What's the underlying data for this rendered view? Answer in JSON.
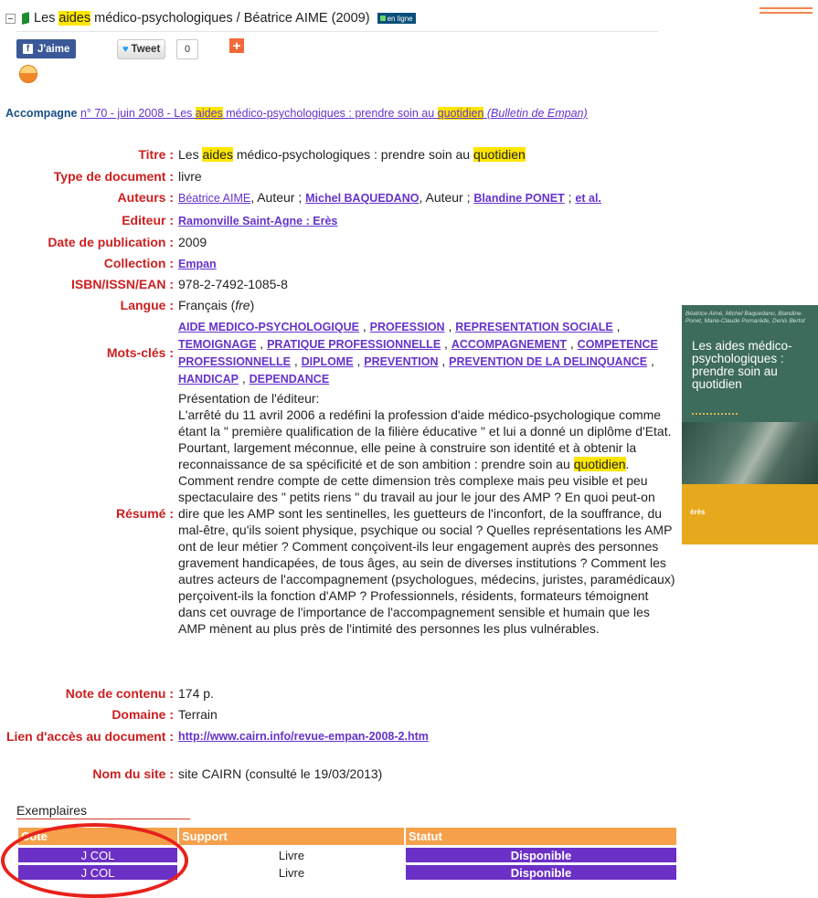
{
  "header": {
    "title_pre": "Les ",
    "title_highlight": "aides",
    "title_post": " médico-psychologiques / Béatrice AIME (2009)",
    "online_badge": "en ligne"
  },
  "share": {
    "facebook_label": "J'aime",
    "tweet_label": "Tweet",
    "tweet_count": "0",
    "plus_label": "+"
  },
  "accompagne": {
    "label": "Accompagne",
    "link_pre": "n° 70 - juin 2008 - Les ",
    "link_hl1": "aides",
    "link_mid": " médico-psychologiques : prendre soin au ",
    "link_hl2": "quotidien",
    "link_post": " (Bulletin de Empan)"
  },
  "fields": {
    "titre": {
      "label": "Titre :",
      "pre": "Les ",
      "hl1": "aides",
      "mid": " médico-psychologiques : prendre soin au ",
      "hl2": "quotidien"
    },
    "type": {
      "label": "Type de document :",
      "value": "livre"
    },
    "auteurs": {
      "label": "Auteurs :",
      "a1": "Béatrice AIME",
      "role": ", Auteur ; ",
      "a2": "Michel BAQUEDANO",
      "role2": ", Auteur ; ",
      "a3": "Blandine PONET",
      "sep": " ; ",
      "a4": "et al."
    },
    "editeur": {
      "label": "Editeur :",
      "value": "Ramonville Saint-Agne : Erès"
    },
    "date": {
      "label": "Date de publication :",
      "value": "2009"
    },
    "collection": {
      "label": "Collection :",
      "value": "Empan"
    },
    "isbn": {
      "label": "ISBN/ISSN/EAN :",
      "value": "978-2-7492-1085-8"
    },
    "langue": {
      "label": "Langue :",
      "value": "Français",
      "code": "fre"
    },
    "mots_cles": {
      "label": "Mots-clés :",
      "items": [
        "AIDE MEDICO-PSYCHOLOGIQUE",
        "PROFESSION",
        "REPRESENTATION SOCIALE",
        "TEMOIGNAGE",
        "PRATIQUE PROFESSIONNELLE",
        "ACCOMPAGNEMENT",
        "COMPETENCE PROFESSIONNELLE",
        "DIPLOME",
        "PREVENTION",
        "PREVENTION DE LA DELINQUANCE",
        "HANDICAP",
        "DEPENDANCE"
      ]
    },
    "resume": {
      "label": "Résumé :",
      "intro": "Présentation de l'éditeur:",
      "p1": "L'arrêté du 11 avril 2006 a redéfini la profession d'aide médico-psychologique comme étant la \" première qualification de la filière éducative \" et lui a donné un diplôme d'Etat. Pourtant, largement méconnue, elle peine à construire son identité et à obtenir la reconnaissance de sa spécificité et de son ambition : prendre soin au ",
      "hl": "quotidien",
      "p2": ". Comment rendre compte de cette dimension très complexe mais peu visible et peu spectaculaire des \" petits riens \" du travail au jour le jour des AMP ? En quoi peut-on dire que les AMP sont les sentinelles, les guetteurs de l'inconfort, de la souffrance, du mal-être, qu'ils soient physique, psychique ou social ? Quelles représentations les AMP ont de leur métier ? Comment conçoivent-ils leur engagement auprès des personnes gravement handicapées, de tous âges, au sein de diverses institutions ? Comment les autres acteurs de l'accompagnement (psychologues, médecins, juristes, paramédicaux) perçoivent-ils la fonction d'AMP ? Professionnels, résidents, formateurs témoignent dans cet ouvrage de l'importance de l'accompagnement sensible et humain que les AMP mènent au plus près de l'intimité des personnes les plus vulnérables."
    },
    "note": {
      "label": "Note de contenu :",
      "value": "174 p."
    },
    "domaine": {
      "label": "Domaine :",
      "value": "Terrain"
    },
    "lien": {
      "label": "Lien d'accès au document :",
      "value": "http://www.cairn.info/revue-empan-2008-2.htm"
    },
    "site": {
      "label": "Nom du site :",
      "value": "site CAIRN (consulté le 19/03/2013)"
    }
  },
  "cover": {
    "authors": "Béatrice Aimé, Michel Baquedano, Blandine Ponet, Marie-Claude Pomarède, Denis Bertot",
    "title": "Les aides médico-psychologiques : prendre soin au quotidien",
    "logo": "érès"
  },
  "exemplaires": {
    "title": "Exemplaires",
    "headers": [
      "Cote",
      "Support",
      "Statut"
    ],
    "rows": [
      {
        "cote": "J COL",
        "support": "Livre",
        "statut": "Disponible"
      },
      {
        "cote": "J COL",
        "support": "Livre",
        "statut": "Disponible"
      }
    ]
  },
  "colors": {
    "label_red": "#cc1f1f",
    "link_purple": "#6633cc",
    "highlight": "#ffe600",
    "table_header_orange": "#f6a04b",
    "table_cell_purple": "#6b30c6",
    "annotation_circle": "#e8211a"
  }
}
